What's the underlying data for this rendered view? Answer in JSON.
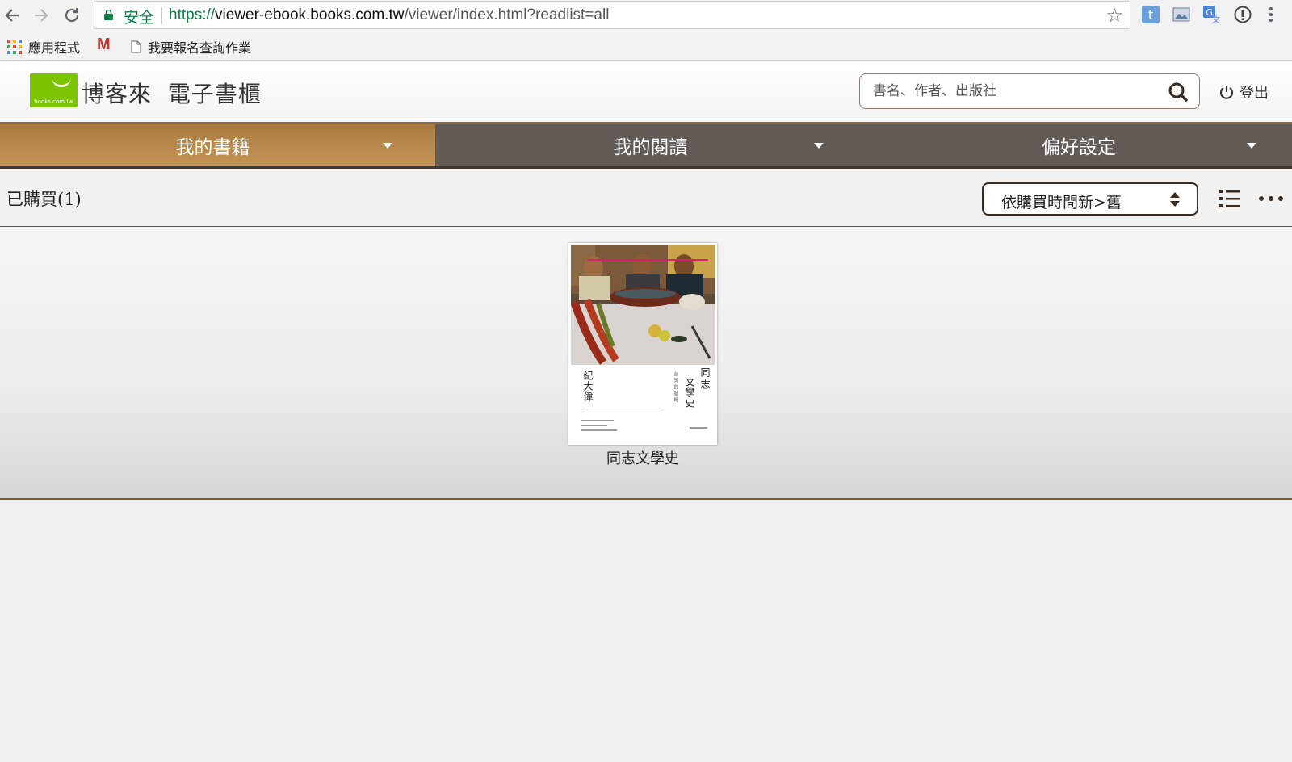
{
  "browser": {
    "secure_label": "安全",
    "url_scheme": "https://",
    "url_host": "viewer-ebook.books.com.tw",
    "url_path": "/viewer/index.html?readlist=all"
  },
  "bookmarks": {
    "apps_label": "應用程式",
    "gmail_label": "M",
    "page_label": "我要報名查詢作業"
  },
  "header": {
    "logo_text": "books.com.tw",
    "title": "博客來  電子書櫃",
    "search_placeholder": "書名、作者、出版社",
    "logout_label": "登出"
  },
  "nav": {
    "tabs": [
      {
        "label": "我的書籍"
      },
      {
        "label": "我的閱讀"
      },
      {
        "label": "偏好設定"
      }
    ]
  },
  "toolbar": {
    "purchased_label": "已購買(1)",
    "sort_value": "依購買時間新>舊"
  },
  "books": [
    {
      "title": "同志文學史",
      "cover_title": "同志文學史",
      "cover_subtitle": "台灣的發明",
      "cover_author": "紀大偉"
    }
  ],
  "colors": {
    "active_tab": "#b8884c",
    "nav_bg": "#625a55",
    "accent_line": "#8b5a2b",
    "logo_green": "#7cc400"
  }
}
